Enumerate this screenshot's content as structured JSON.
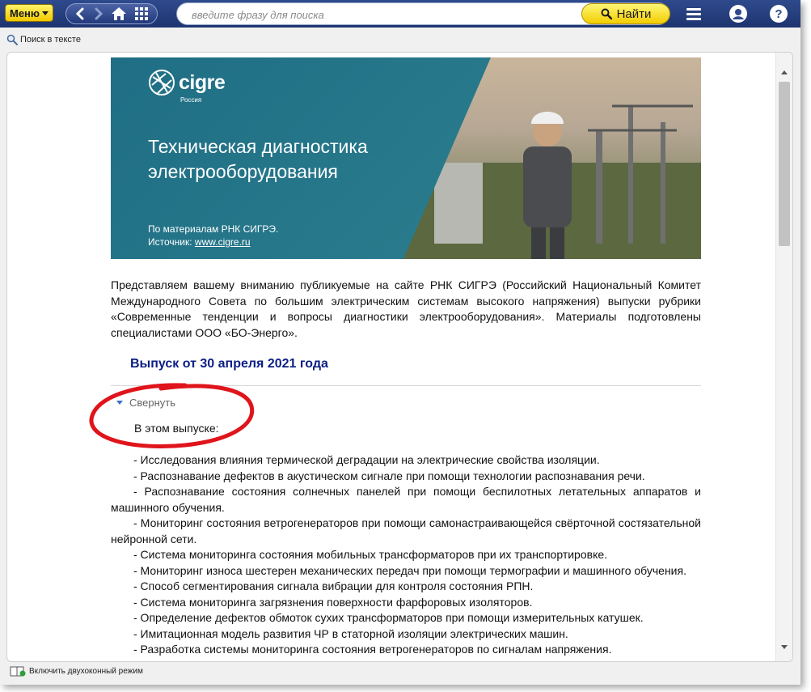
{
  "toolbar": {
    "menu_label": "Меню",
    "search_placeholder": "введите фразу для поиска",
    "find_label": "Найти"
  },
  "subbar": {
    "text_search_label": "Поиск в тексте"
  },
  "banner": {
    "logo_word": "cigre",
    "logo_sub": "Россия",
    "title_line1": "Техническая диагностика",
    "title_line2": "электрооборудования",
    "source_line1": "По материалам РНК СИГРЭ.",
    "source_prefix": "Источник: ",
    "source_link": "www.cigre.ru"
  },
  "content": {
    "intro": "Представляем вашему вниманию публикуемые на сайте РНК СИГРЭ (Российский Национальный Комитет Международного Совета по большим электрическим системам высокого напряжения) выпуски рубрики «Современные тенденции и вопросы диагностики электрооборудования». Материалы подготовлены специалистами ООО «БО-Энерго».",
    "issue_heading": "Выпуск от 30 апреля 2021 года",
    "collapse_label": "Свернуть",
    "in_issue": "В этом выпуске:",
    "items": [
      "- Исследования влияния термической деградации на электрические свойства изоляции.",
      "- Распознавание дефектов в акустическом сигнале при помощи технологии распознавания речи.",
      "- Распознавание состояния солнечных панелей при помощи беспилотных летательных аппаратов и машинного обучения.",
      "- Мониторинг состояния ветрогенераторов при помощи самонастраивающейся свёрточной состязательной нейронной сети.",
      "- Система мониторинга состояния мобильных трансформаторов при их транспортировке.",
      "- Мониторинг износа шестерен механических передач при помощи термографии и машинного обучения.",
      "- Способ сегментирования сигнала вибрации для контроля состояния РПН.",
      "- Система мониторинга загрязнения поверхности фарфоровых изоляторов.",
      "- Определение дефектов обмоток сухих трансформаторов при помощи измерительных катушек.",
      "- Имитационная модель развития ЧР в статорной изоляции электрических машин.",
      "- Разработка системы мониторинга состояния ветрогенераторов по сигналам напряжения."
    ]
  },
  "bottom": {
    "dual_window_label": "Включить двухоконный режим"
  },
  "colors": {
    "toolbar": "#1d3470",
    "accent_yellow": "#f2cd00",
    "heading_blue": "#0b1e84",
    "annotation_red": "#e0141b"
  }
}
